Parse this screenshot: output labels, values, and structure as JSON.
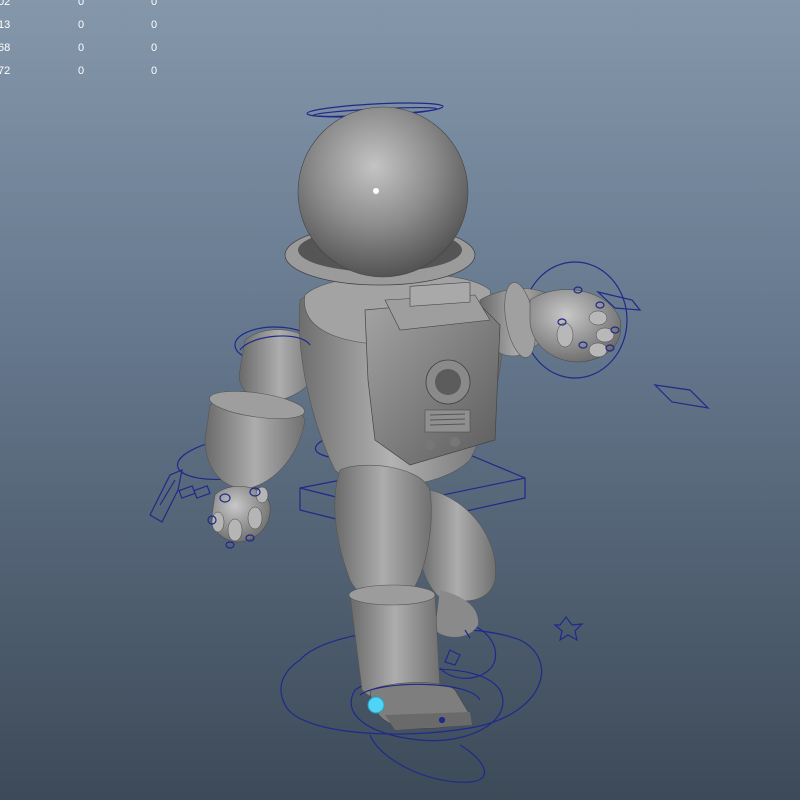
{
  "viewport": {
    "background_top": "#8497ab",
    "background_bottom": "#3d4a58"
  },
  "hud": {
    "rows": [
      [
        "02",
        "0",
        "0"
      ],
      [
        "13",
        "0",
        "0"
      ],
      [
        "68",
        "0",
        "0"
      ],
      [
        "72",
        "0",
        "0"
      ]
    ]
  },
  "scene": {
    "subject": "astronaut character rig",
    "mesh_color": "#9a9a9a",
    "control_curve_color": "#1f2a8a",
    "selected_control_color": "#4fd4f5"
  }
}
